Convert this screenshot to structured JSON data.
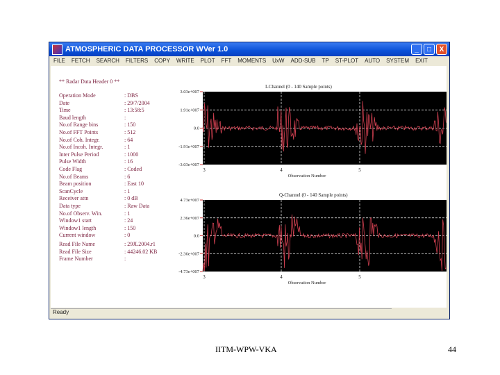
{
  "window": {
    "title": "ATMOSPHERIC DATA PROCESSOR   WVer 1.0",
    "buttons": {
      "minimize": "_",
      "maximize": "□",
      "close": "X"
    }
  },
  "menu": [
    "FILE",
    "FETCH",
    "SEARCH",
    "FILTERS",
    "COPY",
    "WRITE",
    "PLOT",
    "FFT",
    "MOMENTS",
    "UxW",
    "ADD-SUB",
    "TP",
    "ST-PLOT",
    "AUTO",
    "SYSTEM",
    "EXIT"
  ],
  "header": {
    "title": "** Radar Data Header 0 **",
    "fields": [
      {
        "label": "Operation Mode",
        "value": ": DBS"
      },
      {
        "label": "Date",
        "value": ": 29/7/2004"
      },
      {
        "label": "Time",
        "value": ": 13:58:5"
      },
      {
        "label": "Baud length",
        "value": ":"
      },
      {
        "label": "No.of Range bins",
        "value": ": 150"
      },
      {
        "label": "No.of FFT Points",
        "value": ": 512"
      },
      {
        "label": "No.of Coh. Integr.",
        "value": ": 64"
      },
      {
        "label": "No.of Incoh. Integr.",
        "value": ": 1"
      },
      {
        "label": "Inter Pulse Period",
        "value": ": 1000"
      },
      {
        "label": "Pulse Width",
        "value": ": 16"
      },
      {
        "label": "Code Flag",
        "value": ": Coded"
      },
      {
        "label": "No.of Beams",
        "value": ": 6"
      },
      {
        "label": "Beam position",
        "value": ": East 10"
      },
      {
        "label": "ScanCycle",
        "value": ": 1"
      },
      {
        "label": "Receiver attn",
        "value": ": 0 dB"
      },
      {
        "label": "Data type",
        "value": ": Raw Data"
      },
      {
        "label": "No.of Observ. Win.",
        "value": ": 1"
      },
      {
        "label": "Window1 start",
        "value": ": 24"
      },
      {
        "label": "Window1 length",
        "value": ": 150"
      },
      {
        "label": "Current window",
        "value": ": 0"
      },
      {
        "label": "Read File Name",
        "value": ": 29JL2004.r1"
      },
      {
        "label": "Read File Size",
        "value": ": 44246.02 KB"
      },
      {
        "label": "Frame Number",
        "value": ": "
      }
    ]
  },
  "status": "Ready",
  "footer": {
    "center": "IITM-WPW-VKA",
    "page": "44"
  },
  "colors": {
    "plot_bg": "#000000",
    "trace": "#d04050",
    "grid": "#ffffff",
    "text": "#7a1f3d"
  },
  "chart_data": [
    {
      "type": "line",
      "title": "I-Channel (0 - 140 Sample points)",
      "xlabel": "Observation Number",
      "x_ticks": [
        "3",
        "4",
        "5"
      ],
      "y_ticks": [
        "3.03e+007",
        "1.91e+007",
        "0.0",
        "-1.91e+007",
        "-3.03e+007"
      ],
      "ylim": [
        -30300000.0,
        30300000.0
      ],
      "grid": true
    },
    {
      "type": "line",
      "title": "Q-Channel (0 - 140 Sample points)",
      "xlabel": "Observation Number",
      "x_ticks": [
        "3",
        "4",
        "5"
      ],
      "y_ticks": [
        "4.73e+007",
        "2.36e+007",
        "0.0",
        "-2.36e+007",
        "-4.73e+007"
      ],
      "ylim": [
        -47300000.0,
        47300000.0
      ],
      "grid": true
    }
  ]
}
